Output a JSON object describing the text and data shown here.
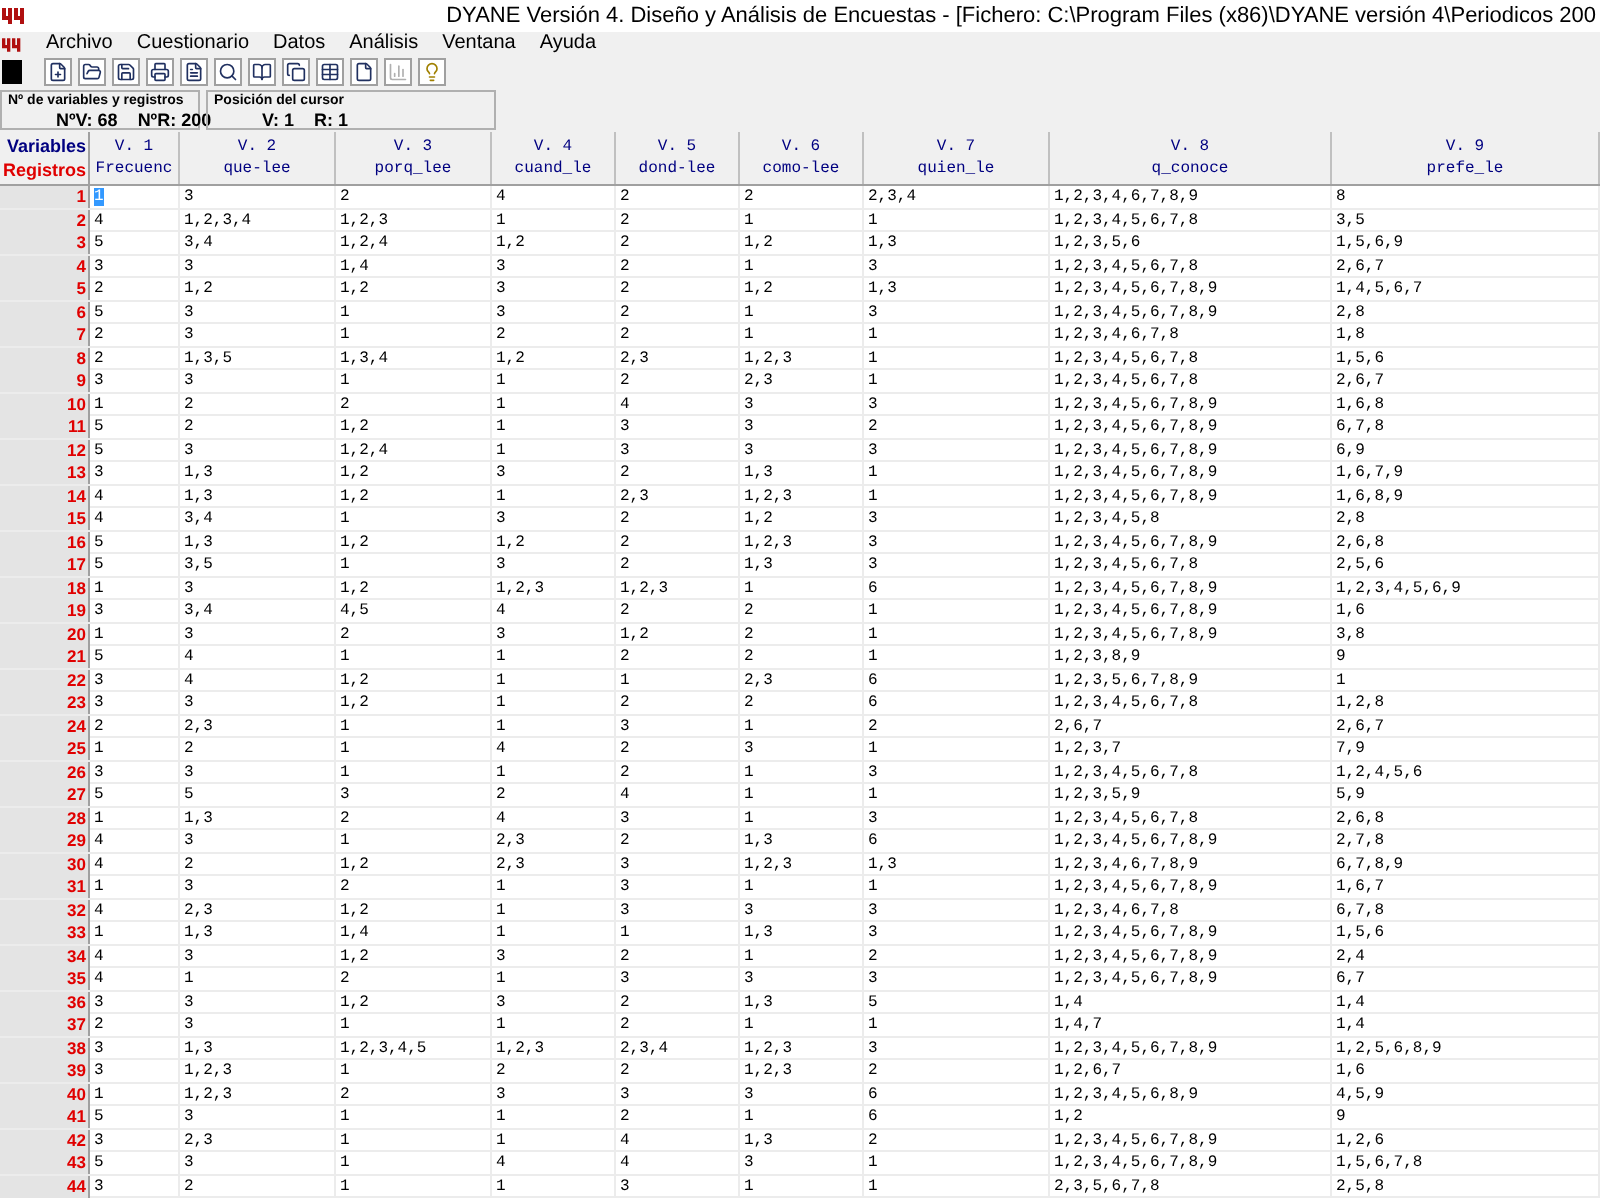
{
  "window": {
    "title": "DYANE Versión 4.  Diseño y  Análisis de Encuestas - [Fichero: C:\\Program Files (x86)\\DYANE versión 4\\Periodicos 200"
  },
  "menu": [
    "Archivo",
    "Cuestionario",
    "Datos",
    "Análisis",
    "Ventana",
    "Ayuda"
  ],
  "info": [
    {
      "title": "Nº de variables y registros",
      "values": [
        "NºV: 68",
        "NºR: 200"
      ]
    },
    {
      "title": "Posición del cursor",
      "values": [
        "V: 1",
        "R: 1"
      ]
    }
  ],
  "table": {
    "corner": [
      "Variables",
      "Registros"
    ],
    "columns": [
      {
        "number": "V. 1",
        "name": "Frecuenc"
      },
      {
        "number": "V. 2",
        "name": "que-lee"
      },
      {
        "number": "V. 3",
        "name": "porq_lee"
      },
      {
        "number": "V. 4",
        "name": "cuand_le"
      },
      {
        "number": "V. 5",
        "name": "dond-lee"
      },
      {
        "number": "V. 6",
        "name": "como-lee"
      },
      {
        "number": "V. 7",
        "name": "quien_le"
      },
      {
        "number": "V. 8",
        "name": "q_conoce"
      },
      {
        "number": "V. 9",
        "name": "prefe_le"
      }
    ],
    "rows": [
      {
        "label": "1",
        "selected": true,
        "cells": [
          "1",
          "3",
          "2",
          "4",
          "2",
          "2",
          "2,3,4",
          "1,2,3,4,6,7,8,9",
          "8"
        ]
      },
      {
        "label": "2",
        "selected": false,
        "cells": [
          "4",
          "1,2,3,4",
          "1,2,3",
          "1",
          "2",
          "1",
          "1",
          "1,2,3,4,5,6,7,8",
          "3,5"
        ]
      },
      {
        "label": "3",
        "selected": false,
        "cells": [
          "5",
          "3,4",
          "1,2,4",
          "1,2",
          "2",
          "1,2",
          "1,3",
          "1,2,3,5,6",
          "1,5,6,9"
        ]
      },
      {
        "label": "4",
        "selected": false,
        "cells": [
          "3",
          "3",
          "1,4",
          "3",
          "2",
          "1",
          "3",
          "1,2,3,4,5,6,7,8",
          "2,6,7"
        ]
      },
      {
        "label": "5",
        "selected": false,
        "cells": [
          "2",
          "1,2",
          "1,2",
          "3",
          "2",
          "1,2",
          "1,3",
          "1,2,3,4,5,6,7,8,9",
          "1,4,5,6,7"
        ]
      },
      {
        "label": "6",
        "selected": false,
        "cells": [
          "5",
          "3",
          "1",
          "3",
          "2",
          "1",
          "3",
          "1,2,3,4,5,6,7,8,9",
          "2,8"
        ]
      },
      {
        "label": "7",
        "selected": false,
        "cells": [
          "2",
          "3",
          "1",
          "2",
          "2",
          "1",
          "1",
          "1,2,3,4,6,7,8",
          "1,8"
        ]
      },
      {
        "label": "8",
        "selected": false,
        "cells": [
          "2",
          "1,3,5",
          "1,3,4",
          "1,2",
          "2,3",
          "1,2,3",
          "1",
          "1,2,3,4,5,6,7,8",
          "1,5,6"
        ]
      },
      {
        "label": "9",
        "selected": false,
        "cells": [
          "3",
          "3",
          "1",
          "1",
          "2",
          "2,3",
          "1",
          "1,2,3,4,5,6,7,8",
          "2,6,7"
        ]
      },
      {
        "label": "10",
        "selected": false,
        "cells": [
          "1",
          "2",
          "2",
          "1",
          "4",
          "3",
          "3",
          "1,2,3,4,5,6,7,8,9",
          "1,6,8"
        ]
      },
      {
        "label": "11",
        "selected": false,
        "cells": [
          "5",
          "2",
          "1,2",
          "1",
          "3",
          "3",
          "2",
          "1,2,3,4,5,6,7,8,9",
          "6,7,8"
        ]
      },
      {
        "label": "12",
        "selected": false,
        "cells": [
          "5",
          "3",
          "1,2,4",
          "1",
          "3",
          "3",
          "3",
          "1,2,3,4,5,6,7,8,9",
          "6,9"
        ]
      },
      {
        "label": "13",
        "selected": false,
        "cells": [
          "3",
          "1,3",
          "1,2",
          "3",
          "2",
          "1,3",
          "1",
          "1,2,3,4,5,6,7,8,9",
          "1,6,7,9"
        ]
      },
      {
        "label": "14",
        "selected": false,
        "cells": [
          "4",
          "1,3",
          "1,2",
          "1",
          "2,3",
          "1,2,3",
          "1",
          "1,2,3,4,5,6,7,8,9",
          "1,6,8,9"
        ]
      },
      {
        "label": "15",
        "selected": false,
        "cells": [
          "4",
          "3,4",
          "1",
          "3",
          "2",
          "1,2",
          "3",
          "1,2,3,4,5,8",
          "2,8"
        ]
      },
      {
        "label": "16",
        "selected": false,
        "cells": [
          "5",
          "1,3",
          "1,2",
          "1,2",
          "2",
          "1,2,3",
          "3",
          "1,2,3,4,5,6,7,8,9",
          "2,6,8"
        ]
      },
      {
        "label": "17",
        "selected": false,
        "cells": [
          "5",
          "3,5",
          "1",
          "3",
          "2",
          "1,3",
          "3",
          "1,2,3,4,5,6,7,8",
          "2,5,6"
        ]
      },
      {
        "label": "18",
        "selected": false,
        "cells": [
          "1",
          "3",
          "1,2",
          "1,2,3",
          "1,2,3",
          "1",
          "6",
          "1,2,3,4,5,6,7,8,9",
          "1,2,3,4,5,6,9"
        ]
      },
      {
        "label": "19",
        "selected": false,
        "cells": [
          "3",
          "3,4",
          "4,5",
          "4",
          "2",
          "2",
          "1",
          "1,2,3,4,5,6,7,8,9",
          "1,6"
        ]
      },
      {
        "label": "20",
        "selected": false,
        "cells": [
          "1",
          "3",
          "2",
          "3",
          "1,2",
          "2",
          "1",
          "1,2,3,4,5,6,7,8,9",
          "3,8"
        ]
      },
      {
        "label": "21",
        "selected": false,
        "cells": [
          "5",
          "4",
          "1",
          "1",
          "2",
          "2",
          "1",
          "1,2,3,8,9",
          "9"
        ]
      },
      {
        "label": "22",
        "selected": false,
        "cells": [
          "3",
          "4",
          "1,2",
          "1",
          "1",
          "2,3",
          "6",
          "1,2,3,5,6,7,8,9",
          "1"
        ]
      },
      {
        "label": "23",
        "selected": false,
        "cells": [
          "3",
          "3",
          "1,2",
          "1",
          "2",
          "2",
          "6",
          "1,2,3,4,5,6,7,8",
          "1,2,8"
        ]
      },
      {
        "label": "24",
        "selected": false,
        "cells": [
          "2",
          "2,3",
          "1",
          "1",
          "3",
          "1",
          "2",
          "2,6,7",
          "2,6,7"
        ]
      },
      {
        "label": "25",
        "selected": false,
        "cells": [
          "1",
          "2",
          "1",
          "4",
          "2",
          "3",
          "1",
          "1,2,3,7",
          "7,9"
        ]
      },
      {
        "label": "26",
        "selected": false,
        "cells": [
          "3",
          "3",
          "1",
          "1",
          "2",
          "1",
          "3",
          "1,2,3,4,5,6,7,8",
          "1,2,4,5,6"
        ]
      },
      {
        "label": "27",
        "selected": false,
        "cells": [
          "5",
          "5",
          "3",
          "2",
          "4",
          "1",
          "1",
          "1,2,3,5,9",
          "5,9"
        ]
      },
      {
        "label": "28",
        "selected": false,
        "cells": [
          "1",
          "1,3",
          "2",
          "4",
          "3",
          "1",
          "3",
          "1,2,3,4,5,6,7,8",
          "2,6,8"
        ]
      },
      {
        "label": "29",
        "selected": false,
        "cells": [
          "4",
          "3",
          "1",
          "2,3",
          "2",
          "1,3",
          "6",
          "1,2,3,4,5,6,7,8,9",
          "2,7,8"
        ]
      },
      {
        "label": "30",
        "selected": false,
        "cells": [
          "4",
          "2",
          "1,2",
          "2,3",
          "3",
          "1,2,3",
          "1,3",
          "1,2,3,4,6,7,8,9",
          "6,7,8,9"
        ]
      },
      {
        "label": "31",
        "selected": false,
        "cells": [
          "1",
          "3",
          "2",
          "1",
          "3",
          "1",
          "1",
          "1,2,3,4,5,6,7,8,9",
          "1,6,7"
        ]
      },
      {
        "label": "32",
        "selected": false,
        "cells": [
          "4",
          "2,3",
          "1,2",
          "1",
          "3",
          "3",
          "3",
          "1,2,3,4,6,7,8",
          "6,7,8"
        ]
      },
      {
        "label": "33",
        "selected": false,
        "cells": [
          "1",
          "1,3",
          "1,4",
          "1",
          "1",
          "1,3",
          "3",
          "1,2,3,4,5,6,7,8,9",
          "1,5,6"
        ]
      },
      {
        "label": "34",
        "selected": false,
        "cells": [
          "4",
          "3",
          "1,2",
          "3",
          "2",
          "1",
          "2",
          "1,2,3,4,5,6,7,8,9",
          "2,4"
        ]
      },
      {
        "label": "35",
        "selected": false,
        "cells": [
          "4",
          "1",
          "2",
          "1",
          "3",
          "3",
          "3",
          "1,2,3,4,5,6,7,8,9",
          "6,7"
        ]
      },
      {
        "label": "36",
        "selected": false,
        "cells": [
          "3",
          "3",
          "1,2",
          "3",
          "2",
          "1,3",
          "5",
          "1,4",
          "1,4"
        ]
      },
      {
        "label": "37",
        "selected": false,
        "cells": [
          "2",
          "3",
          "1",
          "1",
          "2",
          "1",
          "1",
          "1,4,7",
          "1,4"
        ]
      },
      {
        "label": "38",
        "selected": false,
        "cells": [
          "3",
          "1,3",
          "1,2,3,4,5",
          "1,2,3",
          "2,3,4",
          "1,2,3",
          "3",
          "1,2,3,4,5,6,7,8,9",
          "1,2,5,6,8,9"
        ]
      },
      {
        "label": "39",
        "selected": false,
        "cells": [
          "3",
          "1,2,3",
          "1",
          "2",
          "2",
          "1,2,3",
          "2",
          "1,2,6,7",
          "1,6"
        ]
      },
      {
        "label": "40",
        "selected": false,
        "cells": [
          "1",
          "1,2,3",
          "2",
          "3",
          "3",
          "3",
          "6",
          "1,2,3,4,5,6,8,9",
          "4,5,9"
        ]
      },
      {
        "label": "41",
        "selected": false,
        "cells": [
          "5",
          "3",
          "1",
          "1",
          "2",
          "1",
          "6",
          "1,2",
          "9"
        ]
      },
      {
        "label": "42",
        "selected": false,
        "cells": [
          "3",
          "2,3",
          "1",
          "1",
          "4",
          "1,3",
          "2",
          "1,2,3,4,5,6,7,8,9",
          "1,2,6"
        ]
      },
      {
        "label": "43",
        "selected": false,
        "cells": [
          "5",
          "3",
          "1",
          "4",
          "4",
          "3",
          "1",
          "1,2,3,4,5,6,7,8,9",
          "1,5,6,7,8"
        ]
      },
      {
        "label": "44",
        "selected": false,
        "cells": [
          "3",
          "2",
          "1",
          "1",
          "3",
          "1",
          "1",
          "2,3,5,6,7,8",
          "2,5,8"
        ]
      }
    ]
  }
}
